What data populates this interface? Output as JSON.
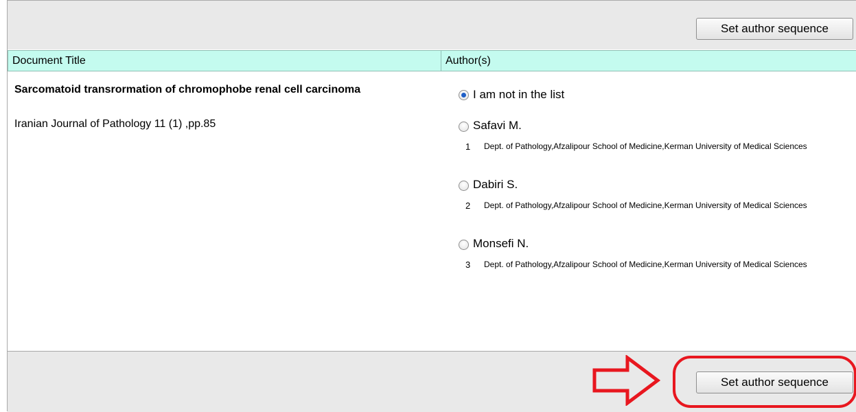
{
  "toolbar": {
    "set_sequence_label": "Set author sequence"
  },
  "table": {
    "headers": {
      "title": "Document Title",
      "authors": "Author(s)"
    }
  },
  "document": {
    "title": "Sarcomatoid transrormation of chromophobe renal cell carcinoma",
    "source": "Iranian Journal of Pathology 11 (1) ,pp.85"
  },
  "authors": {
    "not_in_list_label": "I am not in the list",
    "items": [
      {
        "number": "1",
        "name": "Safavi M.",
        "affiliation": "Dept. of Pathology,Afzalipour School of Medicine,Kerman University of Medical Sciences"
      },
      {
        "number": "2",
        "name": "Dabiri S.",
        "affiliation": "Dept. of Pathology,Afzalipour School of Medicine,Kerman University of Medical Sciences"
      },
      {
        "number": "3",
        "name": "Monsefi N.",
        "affiliation": "Dept. of Pathology,Afzalipour School of Medicine,Kerman University of Medical Sciences"
      }
    ],
    "selected": "not_in_list"
  },
  "footer": {
    "set_sequence_label": "Set author sequence"
  },
  "colors": {
    "header_bg": "#c4fbef",
    "bar_bg": "#e9e9e9",
    "annotation": "#e8171f"
  },
  "annotations": {
    "arrow": "right-arrow-icon",
    "highlight": "circle-highlight"
  }
}
